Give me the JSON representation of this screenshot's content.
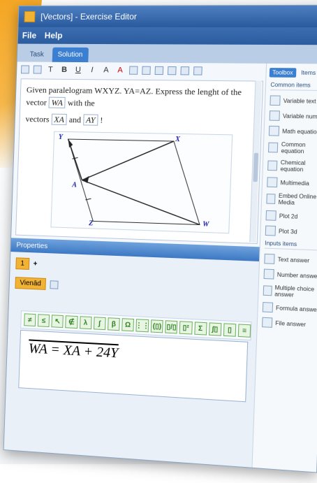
{
  "window": {
    "title": "[Vectors] - Exercise Editor"
  },
  "menu": {
    "file": "File",
    "help": "Help"
  },
  "tabs": [
    {
      "label": "Task"
    },
    {
      "label": "Solution"
    }
  ],
  "editor": {
    "line1": "Given paralelogram WXYZ. YA=AZ. Express the lenght of the vector",
    "vec_wa": "WA",
    "with_the": "with the",
    "line2_prefix": "vectors",
    "vec_xa": "XA",
    "and": "and",
    "vec_ay": "AY",
    "bang": "!"
  },
  "graph": {
    "labels": {
      "Y": "Y",
      "X": "X",
      "A": "A",
      "Z": "Z",
      "W": "W"
    }
  },
  "properties": {
    "title": "Properties",
    "page_value": "1",
    "plus": "+",
    "language_dropdown": "Vienād",
    "formula": "WA = XA + 24Y",
    "symbols": [
      "≠",
      "≤",
      "↖",
      "∉",
      "λ",
      "∫",
      "β",
      "Ω",
      "⋮⋮",
      "(▯)",
      "▯/▯",
      "▯²",
      "Σ",
      "∫▯",
      "▯",
      "≡"
    ]
  },
  "toolbox": {
    "tabs": [
      "Toolbox",
      "Items"
    ],
    "common_title": "Common items",
    "common": [
      "Variable text",
      "Variable number",
      "Math equation",
      "Common equation",
      "Chemical equation",
      "Multimedia",
      "Embed Online Media",
      "Plot 2d",
      "Plot 3d"
    ],
    "inputs_title": "Inputs items",
    "inputs": [
      "Text answer",
      "Number answer",
      "Multiple choice answer",
      "Formula answer",
      "File answer"
    ]
  },
  "colors": {
    "accent": "#3b7fd0",
    "brand_orange": "#f2b233",
    "title_blue": "#2a5a9e"
  }
}
